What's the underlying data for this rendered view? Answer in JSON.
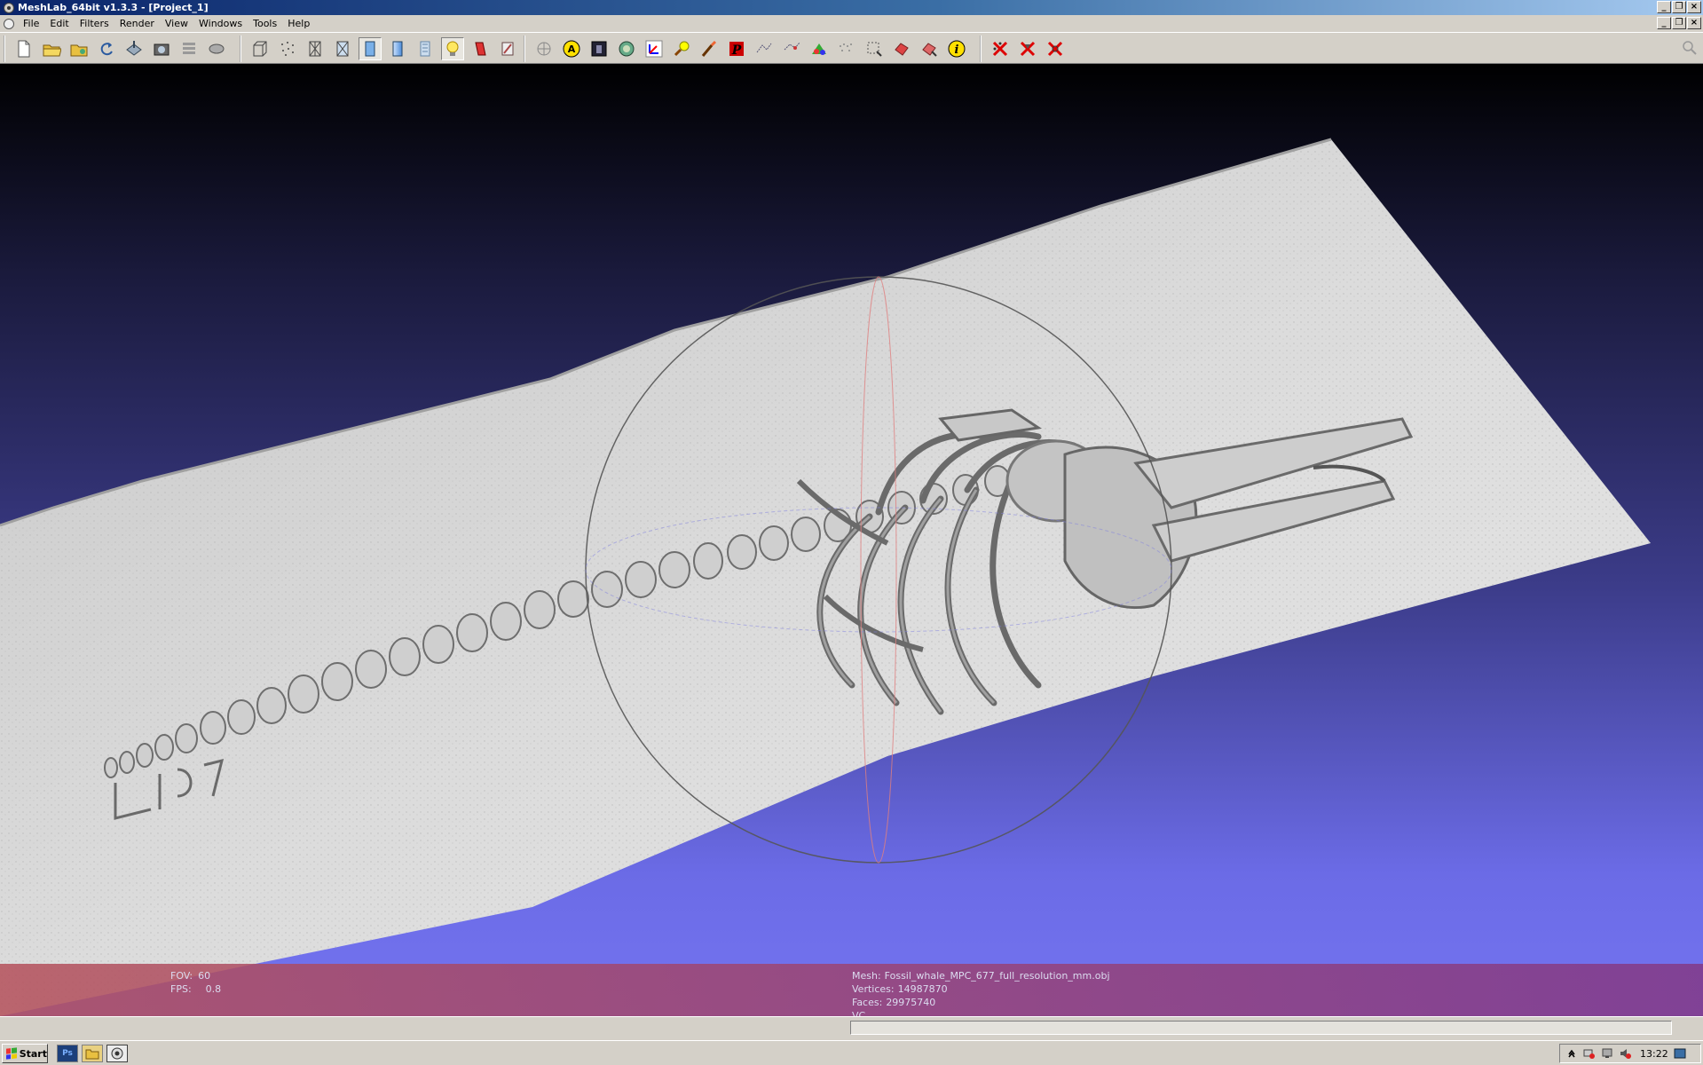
{
  "window": {
    "title": "MeshLab_64bit v1.3.3 - [Project_1]"
  },
  "menu": {
    "items": [
      "File",
      "Edit",
      "Filters",
      "Render",
      "View",
      "Windows",
      "Tools",
      "Help"
    ]
  },
  "toolbar": {
    "groups": [
      [
        "new-icon",
        "open-icon",
        "open-project-icon",
        "reload-icon",
        "export-icon",
        "snapshot-icon",
        "layers-icon",
        "save-icon"
      ],
      [
        "bbox-icon",
        "points-icon",
        "wireframe-icon",
        "hidden-lines-icon",
        "flat-icon",
        "smooth-icon",
        "texture-icon",
        "light-icon",
        "double-side-icon",
        "fancy-light-icon"
      ],
      [
        "manipulator-icon",
        "annotate-icon",
        "raster-icon",
        "measure-icon",
        "axis-icon",
        "paint-icon",
        "brush-icon",
        "pick-points-icon",
        "align-icon",
        "transform-icon",
        "color-icon",
        "reference-icon",
        "select-vertices-icon",
        "select-faces-icon",
        "select-connected-icon",
        "info-icon"
      ],
      [
        "delete-vertices-icon",
        "delete-faces-icon",
        "delete-selection-icon"
      ]
    ]
  },
  "info": {
    "fov_label": "FOV:",
    "fov_value": "60",
    "fps_label": "FPS:",
    "fps_value": "0.8",
    "mesh_label": "Mesh:",
    "mesh_name": "Fossil_whale_MPC_677_full_resolution_mm.obj",
    "vertices_label": "Vertices:",
    "vertices_value": "14987870",
    "faces_label": "Faces:",
    "faces_value": "29975740",
    "vc_label": "VC"
  },
  "taskbar": {
    "start_label": "Start",
    "quick_launch": [
      "photoshop-icon",
      "explorer-icon",
      "meshlab-task-icon"
    ],
    "clock": "13:22"
  },
  "colors": {
    "viewport_top": "#000000",
    "viewport_bottom": "#7474f0",
    "mesh": "#d9d9d9",
    "info_bar": "#9a4a86"
  }
}
